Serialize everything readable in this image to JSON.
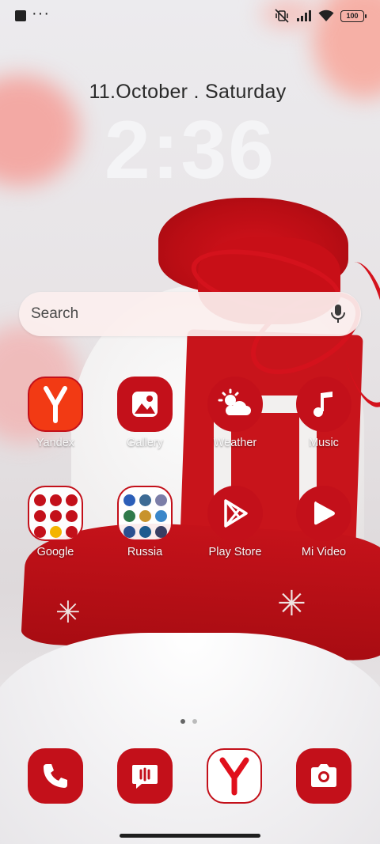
{
  "status_bar": {
    "notification_icons": [
      "app-notification-square-icon",
      "more-notifications-icon"
    ],
    "more_text": "···",
    "icons": [
      "mute-vibrate-icon",
      "signal-icon",
      "wifi-icon",
      "battery-icon"
    ],
    "battery": "100"
  },
  "clock": {
    "date": "11.October . Saturday",
    "time": "2:36"
  },
  "search": {
    "placeholder": "Search",
    "mic_icon": "mic-icon"
  },
  "apps": [
    {
      "label": "Yandex",
      "icon": "yandex-icon"
    },
    {
      "label": "Gallery",
      "icon": "gallery-icon"
    },
    {
      "label": "Weather",
      "icon": "weather-icon"
    },
    {
      "label": "Music",
      "icon": "music-icon"
    },
    {
      "label": "Google",
      "icon": "google-folder-icon"
    },
    {
      "label": "Russia",
      "icon": "russia-folder-icon"
    },
    {
      "label": "Play Store",
      "icon": "play-store-icon"
    },
    {
      "label": "Mi Video",
      "icon": "mi-video-icon"
    }
  ],
  "page_indicator": {
    "current": 1,
    "total": 2
  },
  "dock": [
    "phone-icon",
    "messages-icon",
    "yandex-browser-icon",
    "camera-icon"
  ],
  "colors": {
    "accent": "#c3101a",
    "label": "#f6f6f6"
  }
}
